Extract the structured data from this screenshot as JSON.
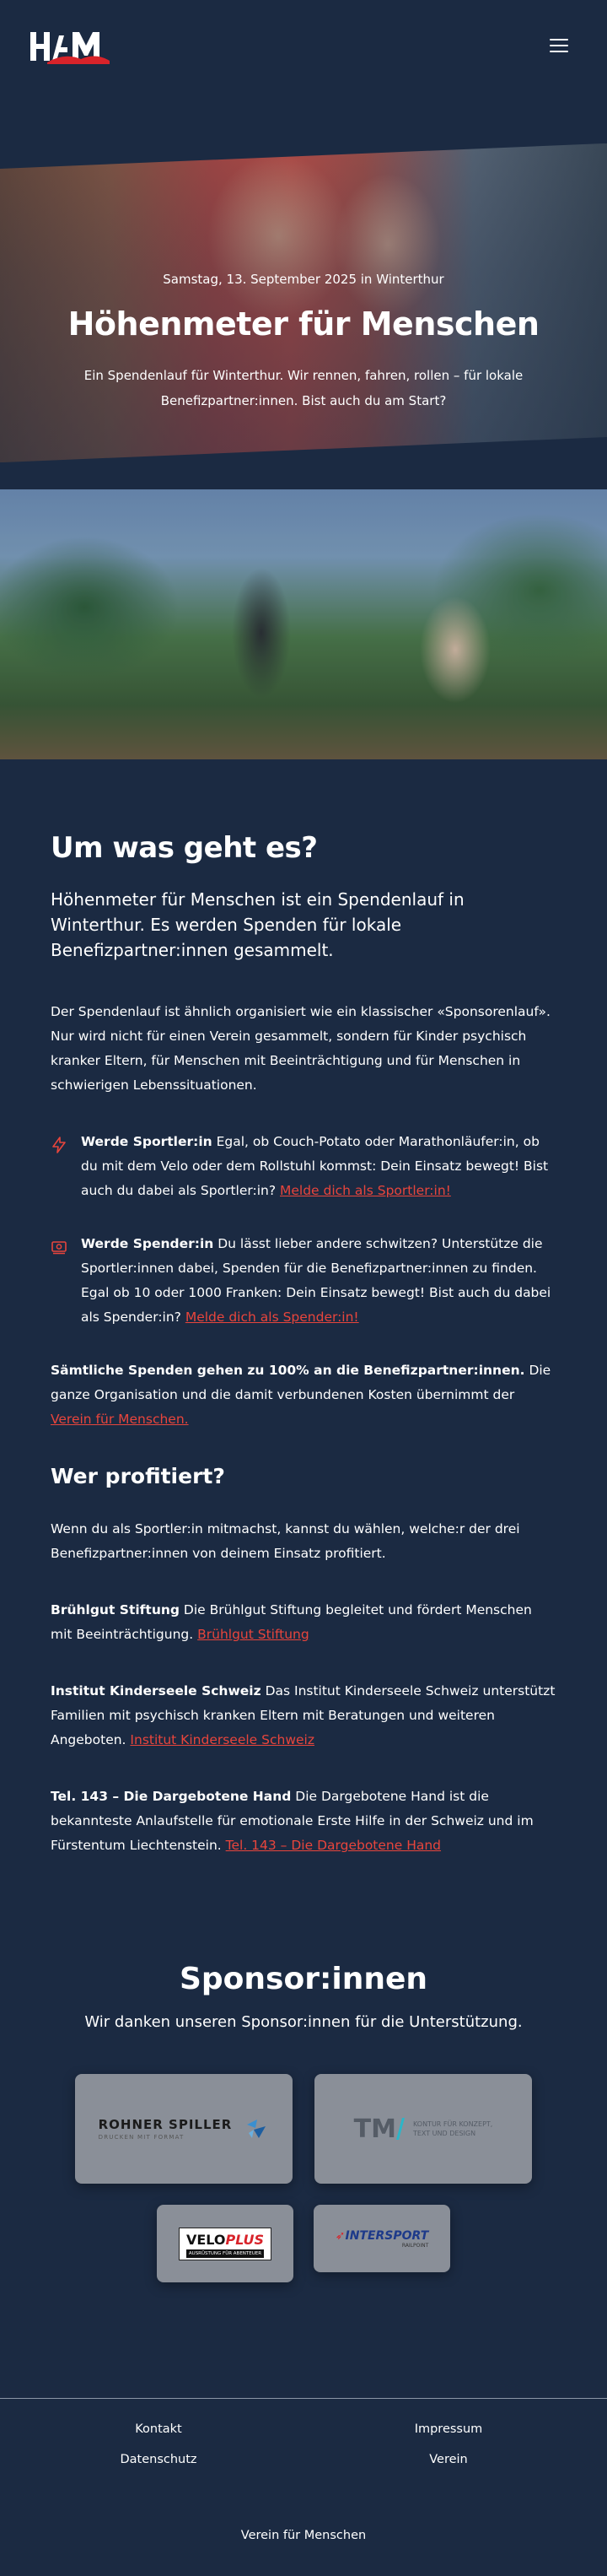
{
  "header": {
    "logo_text": "HfM",
    "menu_icon": "hamburger-icon"
  },
  "hero": {
    "date": "Samstag, 13. September 2025 in Winterthur",
    "title": "Höhenmeter für Menschen",
    "subtitle": "Ein Spendenlauf für Winterthur. Wir rennen, fahren, rollen – für lokale Benefizpartner:innen. Bist auch du am Start?"
  },
  "about": {
    "title": "Um was geht es?",
    "lead": "Höhenmeter für Menschen ist ein Spendenlauf in Winterthur. Es werden Spenden für lokale Benefizpartner:innen gesammelt.",
    "intro": "Der Spendenlauf ist ähnlich organisiert wie ein klassischer «Sponsorenlauf». Nur wird nicht für einen Verein gesammelt, sondern für Kinder psychisch kranker Eltern, für Menschen mit Beeinträchtigung und für Menschen in schwierigen Lebenssituationen.",
    "athlete": {
      "icon": "lightning-icon",
      "heading": "Werde Sportler:in",
      "text": " Egal, ob Couch-Potato oder Marathonläufer:in, ob du mit dem Velo oder dem Rollstuhl kommst: Dein Einsatz bewegt! Bist auch du dabei als Sportler:in? ",
      "link": "Melde dich als Sportler:in!"
    },
    "donor": {
      "icon": "money-icon",
      "heading": "Werde Spender:in",
      "text": " Du lässt lieber andere schwitzen? Unterstütze die Sportler:innen dabei, Spenden für die Benefizpartner:innen zu finden. Egal ob 10 oder 1000 Franken: Dein Einsatz bewegt! Bist auch du dabei als Spender:in? ",
      "link": "Melde dich als Spender:in!"
    },
    "donation_note": {
      "bold": "Sämtliche Spenden gehen zu 100% an die Benefizpartner:innen.",
      "text": " Die ganze Organisation und die damit verbundenen Kosten übernimmt der ",
      "link": "Verein für Menschen."
    }
  },
  "beneficiaries": {
    "title": "Wer profitiert?",
    "intro": "Wenn du als Sportler:in mitmachst, kannst du wählen, welche:r der drei Benefizpartner:innen von deinem Einsatz profitiert.",
    "items": [
      {
        "name": "Brühlgut Stiftung",
        "text": " Die Brühlgut Stiftung begleitet und fördert Menschen mit Beeinträchtigung. ",
        "link": "Brühlgut Stiftung"
      },
      {
        "name": "Institut Kinderseele Schweiz",
        "text": " Das Institut Kinderseele Schweiz unterstützt Familien mit psychisch kranken Eltern mit Beratungen und weiteren Angeboten. ",
        "link": "Institut Kinderseele Schweiz"
      },
      {
        "name": "Tel. 143 – Die Dargebotene Hand",
        "text": " Die Dargebotene Hand ist die bekannteste Anlaufstelle für emotionale Erste Hilfe in der Schweiz und im Fürstentum Liechtenstein. ",
        "link": "Tel. 143 – Die Dargebotene Hand"
      }
    ]
  },
  "sponsors": {
    "title": "Sponsor:innen",
    "subtitle": "Wir danken unseren Sponsor:innen für die Unterstützung.",
    "rohner": {
      "name": "ROHNER SPILLER",
      "tag": "DRUCKEN MIT FORMAT"
    },
    "tm": {
      "mark": "TM",
      "tag1": "KONTUR FÜR KONZEPT,",
      "tag2": "TEXT UND DESIGN"
    },
    "velo": {
      "name_a": "VELO",
      "name_b": "PLUS",
      "tag": "AUSRÜSTUNG FÜR ABENTEUER"
    },
    "intersport": {
      "name": "INTERSPORT",
      "tag": "RAILPOINT"
    }
  },
  "footer": {
    "kontakt": "Kontakt",
    "datenschutz": "Datenschutz",
    "impressum": "Impressum",
    "verein": "Verein",
    "copyright": "Verein für Menschen"
  },
  "colors": {
    "background": "#1b2a42",
    "accent": "#e8453c",
    "card": "#8a8f98"
  }
}
